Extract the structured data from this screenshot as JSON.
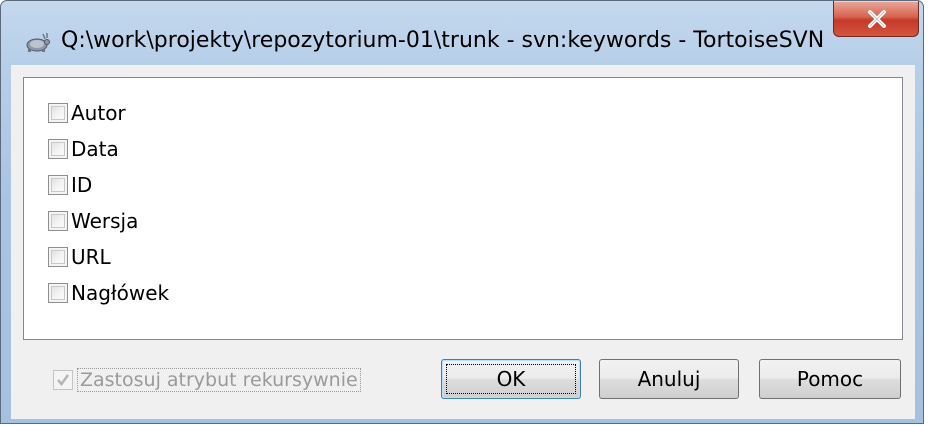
{
  "window": {
    "title": "Q:\\work\\projekty\\repozytorium-01\\trunk - svn:keywords - TortoiseSVN",
    "app_icon": "tortoisesvn-icon",
    "close_icon": "close-icon"
  },
  "keywords": [
    {
      "label": "Autor",
      "checked": false
    },
    {
      "label": "Data",
      "checked": false
    },
    {
      "label": "ID",
      "checked": false
    },
    {
      "label": "Wersja",
      "checked": false
    },
    {
      "label": "URL",
      "checked": false
    },
    {
      "label": "Nagłówek",
      "checked": false
    }
  ],
  "recursive": {
    "label": "Zastosuj atrybut rekursywnie",
    "checked": true,
    "enabled": false
  },
  "buttons": {
    "ok": "OK",
    "cancel": "Anuluj",
    "help": "Pomoc"
  },
  "colors": {
    "frame": "#b7cfe9",
    "close_button": "#c4392a",
    "client_background": "#f0f0f0"
  }
}
